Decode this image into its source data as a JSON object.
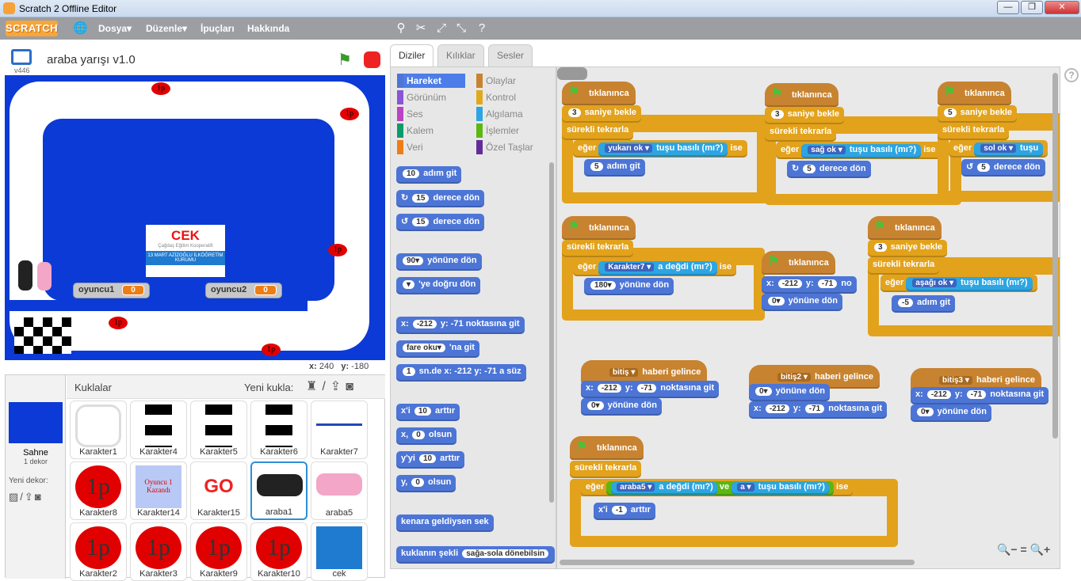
{
  "window": {
    "title": "Scratch 2 Offline Editor",
    "minimize": "—",
    "maximize": "❐",
    "close": "✕"
  },
  "menu": {
    "logo": "SCRATCH",
    "items": [
      "Dosya▾",
      "Düzenle▾",
      "İpuçları",
      "Hakkında"
    ]
  },
  "stage": {
    "title": "araba yarışı v1.0",
    "version": "v446",
    "monitors": [
      {
        "label": "oyuncu1",
        "value": "0"
      },
      {
        "label": "oyuncu2",
        "value": "0"
      }
    ],
    "sign_title": "CEK",
    "sign_sub": "Çağdaş Eğitim Kooperatifi",
    "sign_school": "13 MART AZİZOĞLU İLKÖĞRETİM KURUMU",
    "labels_1p": "1p",
    "coords": {
      "x_label": "x:",
      "x_val": "240",
      "y_label": "y:",
      "y_val": "-180"
    }
  },
  "sprites": {
    "header": "Kuklalar",
    "new_label": "Yeni kukla:",
    "stage_name": "Sahne",
    "stage_count": "1 dekor",
    "new_backdrop": "Yeni dekor:",
    "items": [
      "Karakter1",
      "Karakter4",
      "Karakter5",
      "Karakter6",
      "Karakter7",
      "Karakter8",
      "Karakter14",
      "Karakter15",
      "araba1",
      "araba5",
      "Karakter2",
      "Karakter3",
      "Karakter9",
      "Karakter10",
      "cek"
    ],
    "karakter14_text": "Oyuncu 1 Kazandı",
    "go_text": "GO",
    "label_1p": "1p"
  },
  "tabs": [
    "Diziler",
    "Kılıklar",
    "Sesler"
  ],
  "categories": {
    "left": [
      "Hareket",
      "Görünüm",
      "Ses",
      "Kalem",
      "Veri"
    ],
    "right": [
      "Olaylar",
      "Kontrol",
      "Algılama",
      "İşlemler",
      "Özel Taşlar"
    ],
    "left_colors": [
      "#4c75d6",
      "#8a55d7",
      "#bb42c3",
      "#0e9a6c",
      "#ee7d16"
    ],
    "right_colors": [
      "#c88330",
      "#e1a91a",
      "#2ca5e2",
      "#5cb712",
      "#632d99"
    ]
  },
  "palette_blocks": [
    {
      "pre": "",
      "v": "10",
      "post": " adım git"
    },
    {
      "pre": "↻ ",
      "v": "15",
      "post": " derece dön"
    },
    {
      "pre": "↺ ",
      "v": "15",
      "post": " derece dön"
    },
    {
      "pre": "",
      "v": "90▾",
      "post": " yönüne dön"
    },
    {
      "pre": "",
      "v": "▾",
      "post": " 'ye doğru dön"
    },
    {
      "pre": "x: ",
      "v": "-212",
      "post": " y: -71  noktasına git"
    },
    {
      "pre": "",
      "v": "fare oku▾",
      "post": " 'na git"
    },
    {
      "pre": "",
      "v": "1",
      "post": " sn.de x: -212  y: -71  a süz"
    },
    {
      "pre": "x'i ",
      "v": "10",
      "post": " arttır"
    },
    {
      "pre": "x, ",
      "v": "0",
      "post": " olsun"
    },
    {
      "pre": "y'yi ",
      "v": "10",
      "post": " arttır"
    },
    {
      "pre": "y, ",
      "v": "0",
      "post": " olsun"
    },
    {
      "pre": "kenara geldiysen sek",
      "v": "",
      "post": ""
    },
    {
      "pre": "kuklanın şekli ",
      "v": "sağa-sola dönebilsin",
      "post": ""
    }
  ],
  "scripts": {
    "hat_flag": "tıklanınca",
    "wait": "saniye bekle",
    "forever": "sürekli tekrarla",
    "if": "eğer",
    "then": "ise",
    "key_pressed": "tuşu basılı (mı?)",
    "touching": "a değdi (mı?)",
    "and": "ve",
    "move": "adım git",
    "turn": "derece dön",
    "point": "yönüne dön",
    "goto_xy": "noktasına git",
    "change_x": "arttır",
    "receive": "haberi gelince",
    "keys": [
      "yukarı ok",
      "sağ ok",
      "sol ok",
      "aşağı ok",
      "a"
    ],
    "sprites": [
      "Karakter7",
      "araba5"
    ],
    "messages": [
      "bitiş",
      "bitiş2",
      "bitiş3"
    ],
    "nums": [
      "3",
      "5",
      "180",
      "-5",
      "-212",
      "-71",
      "0",
      "-1"
    ],
    "xi": "x'i",
    "x": "x:",
    "y": "y:"
  },
  "zoom": [
    "🔍−",
    "=",
    "🔍+"
  ]
}
